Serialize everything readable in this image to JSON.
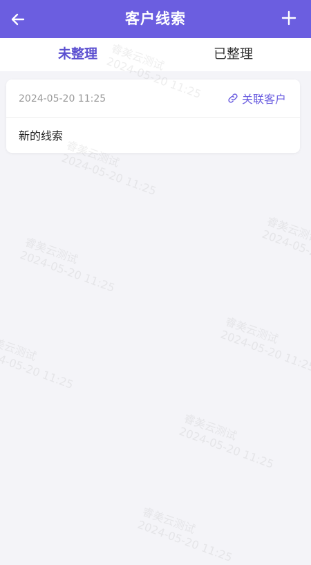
{
  "header": {
    "title": "客户线索",
    "back_icon": "arrow-left-icon",
    "add_icon": "plus-icon",
    "bg_color": "#6b5ee0"
  },
  "tabs": [
    {
      "label": "未整理",
      "active": true
    },
    {
      "label": "已整理",
      "active": false
    }
  ],
  "leads": [
    {
      "time": "2024-05-20 11:25",
      "link_label": "关联客户",
      "link_icon": "link-icon",
      "content": "新的线索"
    }
  ],
  "watermark": {
    "name": "睿美云测试",
    "date": "2024-05-20 11:25"
  },
  "colors": {
    "accent": "#6b5ee0",
    "background": "#f4f4f8"
  }
}
